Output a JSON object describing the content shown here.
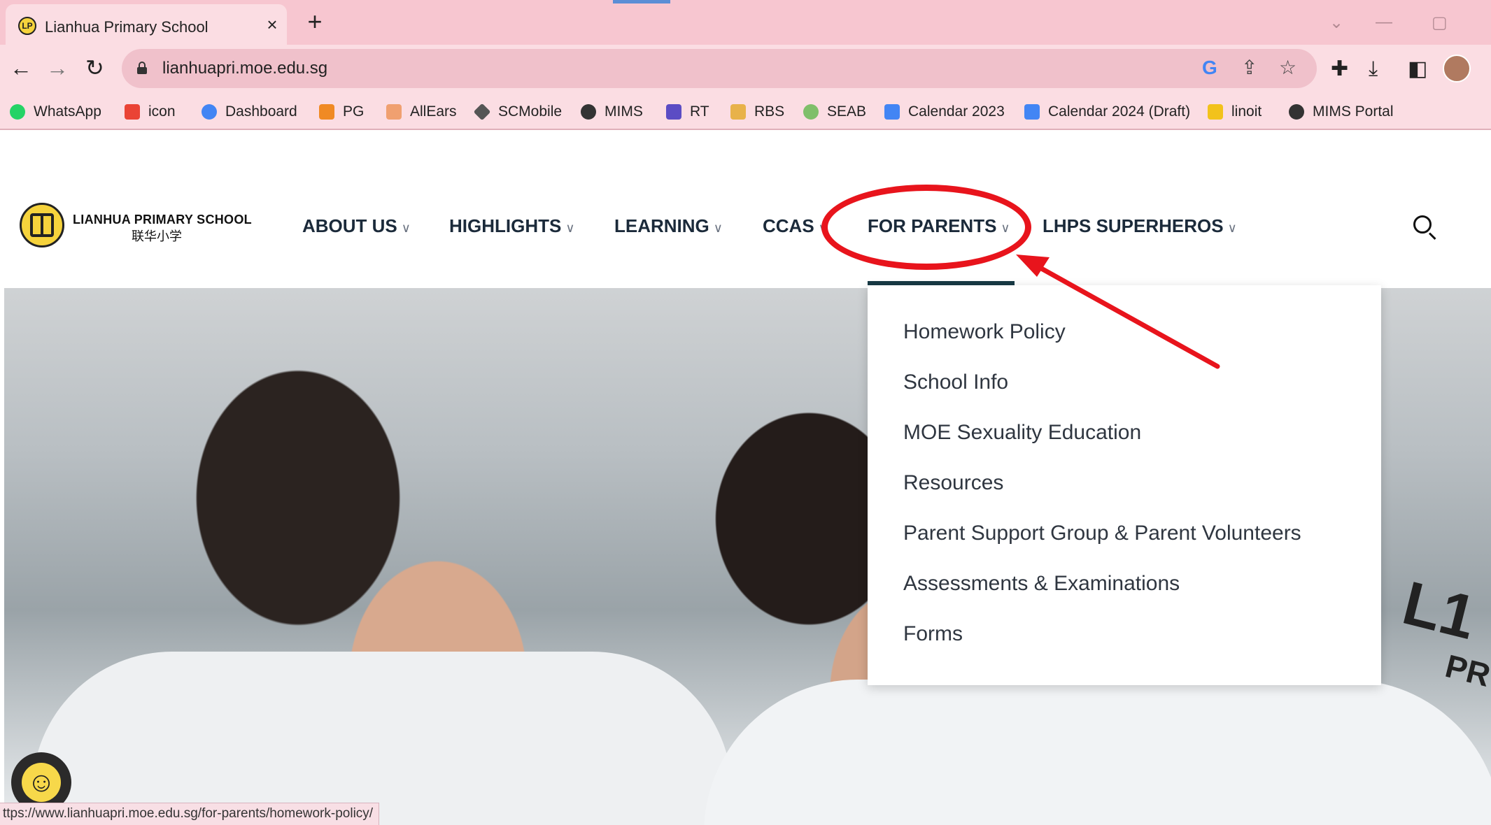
{
  "browser": {
    "tab_title": "Lianhua Primary School",
    "url": "lianhuapri.moe.edu.sg",
    "status_url": "ttps://www.lianhuapri.moe.edu.sg/for-parents/homework-policy/",
    "bookmarks": [
      {
        "label": "WhatsApp",
        "icon": "whatsapp-icon",
        "color": "#25d366"
      },
      {
        "label": "icon",
        "icon": "gmail-icon",
        "color": "#ea4335"
      },
      {
        "label": "Dashboard",
        "icon": "google-icon",
        "color": "#4285f4"
      },
      {
        "label": "PG",
        "icon": "pg-icon",
        "color": "#f08a24"
      },
      {
        "label": "AllEars",
        "icon": "allears-icon",
        "color": "#f0a070"
      },
      {
        "label": "SCMobile",
        "icon": "scmobile-icon",
        "color": "#555555"
      },
      {
        "label": "MIMS",
        "icon": "globe-icon",
        "color": "#333333"
      },
      {
        "label": "RT",
        "icon": "list-icon",
        "color": "#5b4cc4"
      },
      {
        "label": "RBS",
        "icon": "folder-icon",
        "color": "#e8b24a"
      },
      {
        "label": "SEAB",
        "icon": "seab-icon",
        "color": "#7fbf6a"
      },
      {
        "label": "Calendar 2023",
        "icon": "docs-icon",
        "color": "#4285f4"
      },
      {
        "label": "Calendar 2024 (Draft)",
        "icon": "docs-icon",
        "color": "#4285f4"
      },
      {
        "label": "linoit",
        "icon": "linoit-icon",
        "color": "#f2c21b"
      },
      {
        "label": "MIMS Portal",
        "icon": "globe-icon",
        "color": "#333333"
      }
    ]
  },
  "site": {
    "school_name": "LIANHUA PRIMARY SCHOOL",
    "school_name_chinese": "联华小学",
    "nav": [
      {
        "label": "ABOUT US"
      },
      {
        "label": "HIGHLIGHTS"
      },
      {
        "label": "LEARNING"
      },
      {
        "label": "CCAS"
      },
      {
        "label": "FOR PARENTS"
      },
      {
        "label": "LHPS SUPERHEROS"
      }
    ],
    "dropdown": [
      "Homework Policy",
      "School Info",
      "MOE Sexuality Education",
      "Resources",
      "Parent Support Group & Parent Volunteers",
      "Assessments & Examinations",
      "Forms"
    ],
    "hero_text_1": "L1",
    "hero_text_2": "PR"
  },
  "colors": {
    "annotation_red": "#e8141c",
    "nav_text": "#1b2a3a",
    "active_underline": "#183a45",
    "chrome_pink": "#f7c6d0"
  }
}
